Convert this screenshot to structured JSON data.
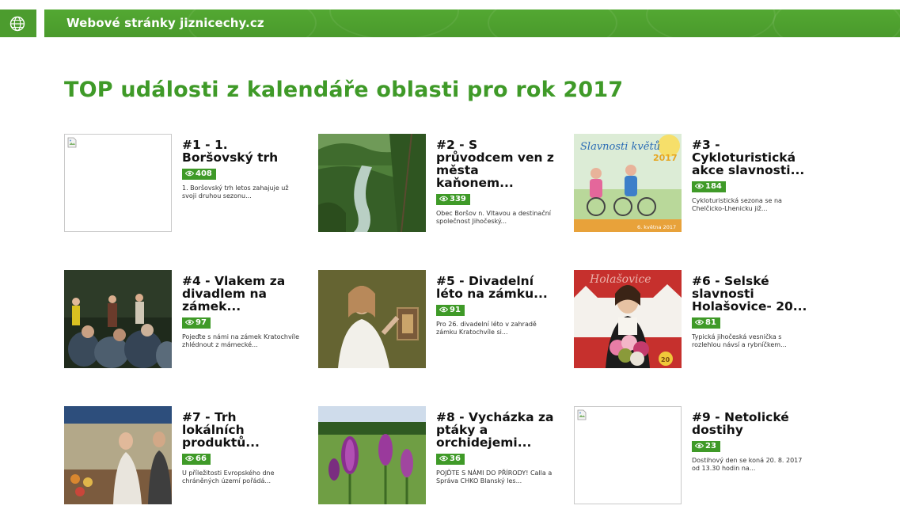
{
  "header": {
    "site_title": "Webové stránky jiznicechy.cz",
    "accent_color": "#4c9c2e",
    "globe_icon": "globe-icon"
  },
  "main": {
    "heading": "TOP události z kalendáře oblasti pro rok 2017",
    "heading_color": "#3f9a28",
    "events": [
      {
        "title": "#1 - 1. Boršovský trh",
        "views": "408",
        "desc": "1. Boršovský trh letos zahajuje už svoji druhou sezonu...",
        "image": "broken-image"
      },
      {
        "title": "#2 - S průvodcem ven z města kaňonem...",
        "views": "339",
        "desc": " Obec Boršov n. Vltavou a destinační společnost Jihočeský...",
        "image": "canyon-photo"
      },
      {
        "title": "#3 - Cykloturistická akce slavnosti...",
        "views": "184",
        "desc": "Cykloturistická sezona se na Chelčicko-Lhenicku již...",
        "image": "poster-slavnosti-kvetu",
        "poster_text": "Slavnosti květů",
        "poster_year": "2017",
        "poster_date": "6. května 2017"
      },
      {
        "title": "#4 - Vlakem za divadlem na zámek...",
        "views": "97",
        "desc": "Pojeďte s námi na zámek Kratochvíle zhlédnout z mámecké...",
        "image": "theatre-photo"
      },
      {
        "title": "#5 - Divadelní léto na zámku...",
        "views": "91",
        "desc": "Pro 26. divadelní léto v zahradě zámku Kratochvíle si...",
        "image": "actress-photo"
      },
      {
        "title": "#6 - Selské slavnosti Holašovice- 20...",
        "views": "81",
        "desc": "Typická jihočeská vesnička s rozlehlou návsí a rybníčkem...",
        "image": "poster-holasovice",
        "poster_text": "Holašovice",
        "poster_badge": "20"
      },
      {
        "title": "#7 - Trh lokálních produktů...",
        "views": "66",
        "desc": "U příležitosti Evropského dne chráněných území pořádá...",
        "image": "market-photo"
      },
      {
        "title": "#8 - Vycházka za ptáky a orchidejemi...",
        "views": "36",
        "desc": "POJĎTE S NÁMI DO PŘÍRODY! Calla a Správa CHKO Blanský les...",
        "image": "orchids-photo"
      },
      {
        "title": "#9 - Netolické dostihy",
        "views": "23",
        "desc": "Dostihový den se koná 20. 8. 2017 od 13.30 hodin na...",
        "image": "broken-image"
      }
    ]
  }
}
